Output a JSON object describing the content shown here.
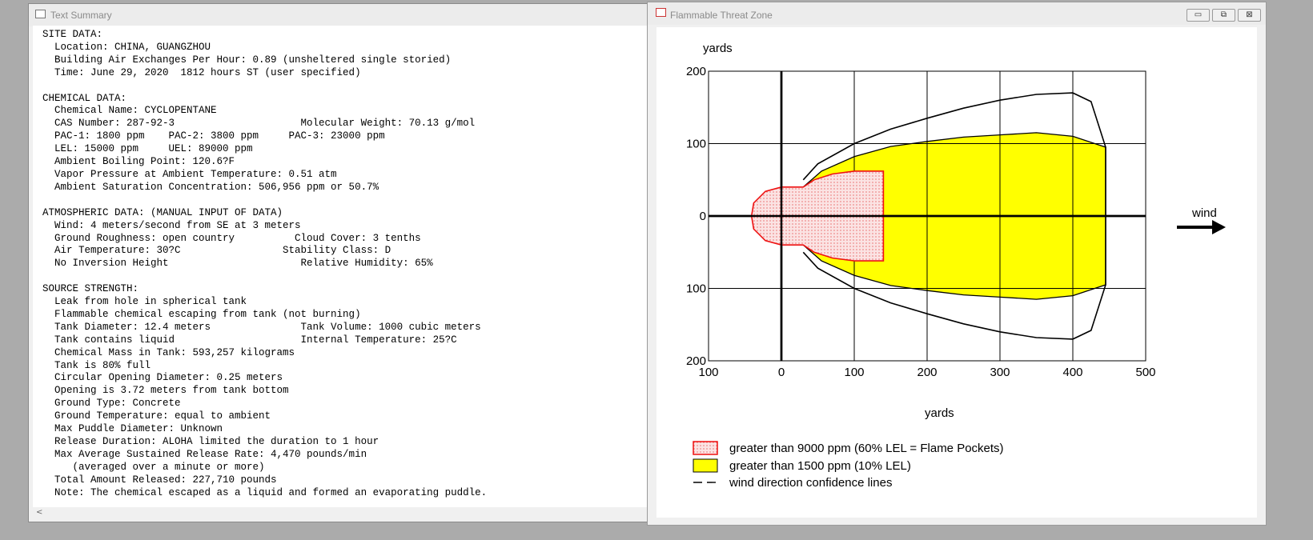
{
  "text_window": {
    "title": "Text Summary",
    "close_glyph": "⊠",
    "lines": [
      "SITE DATA:",
      "  Location: CHINA, GUANGZHOU",
      "  Building Air Exchanges Per Hour: 0.89 (unsheltered single storied)",
      "  Time: June 29, 2020  1812 hours ST (user specified)",
      "",
      "CHEMICAL DATA:",
      "  Chemical Name: CYCLOPENTANE",
      "  CAS Number: 287-92-3                     Molecular Weight: 70.13 g/mol",
      "  PAC-1: 1800 ppm    PAC-2: 3800 ppm     PAC-3: 23000 ppm",
      "  LEL: 15000 ppm     UEL: 89000 ppm",
      "  Ambient Boiling Point: 120.6?F",
      "  Vapor Pressure at Ambient Temperature: 0.51 atm",
      "  Ambient Saturation Concentration: 506,956 ppm or 50.7%",
      "",
      "ATMOSPHERIC DATA: (MANUAL INPUT OF DATA)",
      "  Wind: 4 meters/second from SE at 3 meters",
      "  Ground Roughness: open country          Cloud Cover: 3 tenths",
      "  Air Temperature: 30?C                 Stability Class: D",
      "  No Inversion Height                      Relative Humidity: 65%",
      "",
      "SOURCE STRENGTH:",
      "  Leak from hole in spherical tank",
      "  Flammable chemical escaping from tank (not burning)",
      "  Tank Diameter: 12.4 meters               Tank Volume: 1000 cubic meters",
      "  Tank contains liquid                     Internal Temperature: 25?C",
      "  Chemical Mass in Tank: 593,257 kilograms",
      "  Tank is 80% full",
      "  Circular Opening Diameter: 0.25 meters",
      "  Opening is 3.72 meters from tank bottom",
      "  Ground Type: Concrete",
      "  Ground Temperature: equal to ambient",
      "  Max Puddle Diameter: Unknown",
      "  Release Duration: ALOHA limited the duration to 1 hour",
      "  Max Average Sustained Release Rate: 4,470 pounds/min",
      "     (averaged over a minute or more)",
      "  Total Amount Released: 227,710 pounds",
      "  Note: The chemical escaped as a liquid and formed an evaporating puddle."
    ]
  },
  "threat_window": {
    "title": "Flammable Threat Zone",
    "buttons": {
      "minimize": "▭",
      "restore": "⧉",
      "close": "⊠"
    }
  },
  "chart_data": {
    "type": "area",
    "x_unit_label": "yards",
    "y_unit_label": "yards",
    "x_ticks": [
      "100",
      "0",
      "100",
      "200",
      "300",
      "400",
      "500"
    ],
    "x_tick_values": [
      -100,
      0,
      100,
      200,
      300,
      400,
      500
    ],
    "y_ticks": [
      "200",
      "100",
      "0",
      "100",
      "200"
    ],
    "y_tick_values": [
      200,
      100,
      0,
      -100,
      -200
    ],
    "xlim": [
      -100,
      500
    ],
    "ylim": [
      -200,
      200
    ],
    "grid": true,
    "wind_label": "wind",
    "zones": [
      {
        "name": "greater than 9000 ppm (60% LEL = Flame Pockets)",
        "fill": "#fbe3e3",
        "stroke": "#ee1111",
        "points": [
          [
            0,
            40
          ],
          [
            30,
            40
          ],
          [
            45,
            50
          ],
          [
            70,
            58
          ],
          [
            100,
            62
          ],
          [
            140,
            62
          ],
          [
            140,
            -62
          ],
          [
            100,
            -62
          ],
          [
            70,
            -58
          ],
          [
            45,
            -50
          ],
          [
            30,
            -40
          ],
          [
            0,
            -40
          ],
          [
            -22,
            -34
          ],
          [
            -38,
            -18
          ],
          [
            -41,
            0
          ],
          [
            -38,
            18
          ],
          [
            -22,
            34
          ]
        ]
      },
      {
        "name": "greater than 1500 ppm (10% LEL)",
        "fill": "#ffff00",
        "stroke": "#000000",
        "points": [
          [
            30,
            40
          ],
          [
            55,
            62
          ],
          [
            100,
            82
          ],
          [
            150,
            96
          ],
          [
            200,
            103
          ],
          [
            250,
            109
          ],
          [
            300,
            112
          ],
          [
            350,
            115
          ],
          [
            400,
            110
          ],
          [
            445,
            95
          ],
          [
            445,
            -95
          ],
          [
            400,
            -110
          ],
          [
            350,
            -115
          ],
          [
            300,
            -112
          ],
          [
            250,
            -109
          ],
          [
            200,
            -103
          ],
          [
            150,
            -96
          ],
          [
            100,
            -82
          ],
          [
            55,
            -62
          ],
          [
            30,
            -40
          ]
        ]
      }
    ],
    "confidence_lines": {
      "name": "wind direction confidence lines",
      "points": [
        [
          30,
          50
        ],
        [
          50,
          72
        ],
        [
          100,
          100
        ],
        [
          150,
          120
        ],
        [
          200,
          135
        ],
        [
          250,
          149
        ],
        [
          300,
          160
        ],
        [
          350,
          168
        ],
        [
          400,
          170
        ],
        [
          425,
          158
        ],
        [
          445,
          95
        ],
        [
          445,
          -95
        ],
        [
          425,
          -158
        ],
        [
          400,
          -170
        ],
        [
          350,
          -168
        ],
        [
          300,
          -160
        ],
        [
          250,
          -149
        ],
        [
          200,
          -135
        ],
        [
          150,
          -120
        ],
        [
          100,
          -100
        ],
        [
          50,
          -72
        ],
        [
          30,
          -50
        ]
      ]
    }
  },
  "legend": [
    "greater than 9000 ppm (60% LEL = Flame Pockets)",
    "greater than 1500 ppm (10% LEL)",
    "wind direction confidence lines"
  ],
  "scroll": {
    "left_arrow": "<",
    "right_arrow": ">",
    "up_arrow": "^",
    "down_arrow": "v"
  }
}
